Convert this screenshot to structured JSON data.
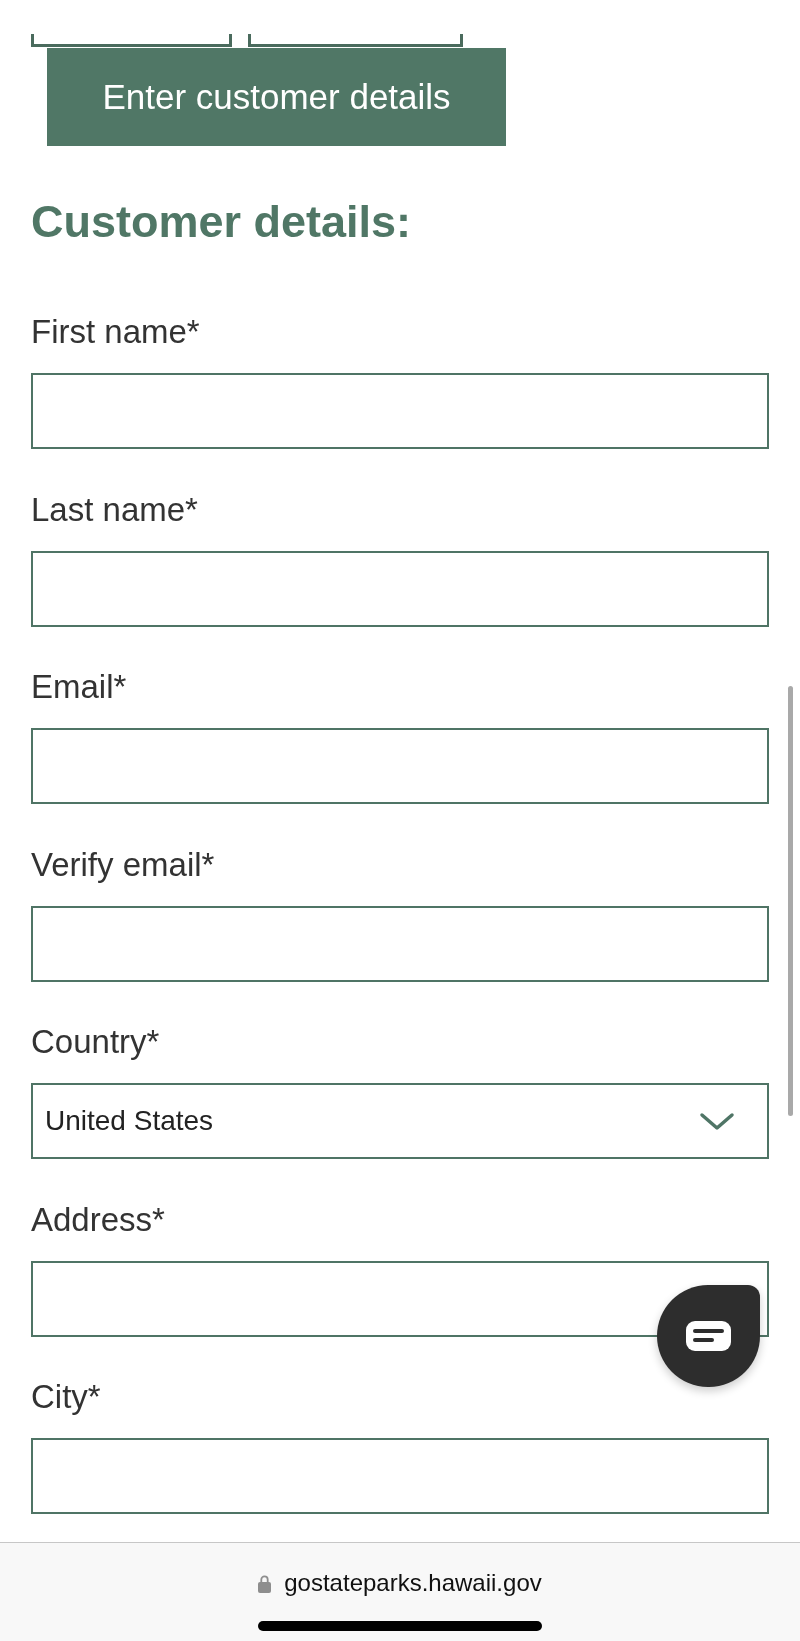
{
  "actions": {
    "enter_details_button": "Enter customer details"
  },
  "section": {
    "title": "Customer details:"
  },
  "fields": [
    {
      "label": "First name*",
      "kind": "text"
    },
    {
      "label": "Last name*",
      "kind": "text"
    },
    {
      "label": "Email*",
      "kind": "text"
    },
    {
      "label": "Verify email*",
      "kind": "text"
    },
    {
      "label": "Country*",
      "kind": "select",
      "value": "United States"
    },
    {
      "label": "Address*",
      "kind": "text"
    },
    {
      "label": "City*",
      "kind": "text"
    }
  ],
  "browser_bar": {
    "url": "gostateparks.hawaii.gov"
  }
}
